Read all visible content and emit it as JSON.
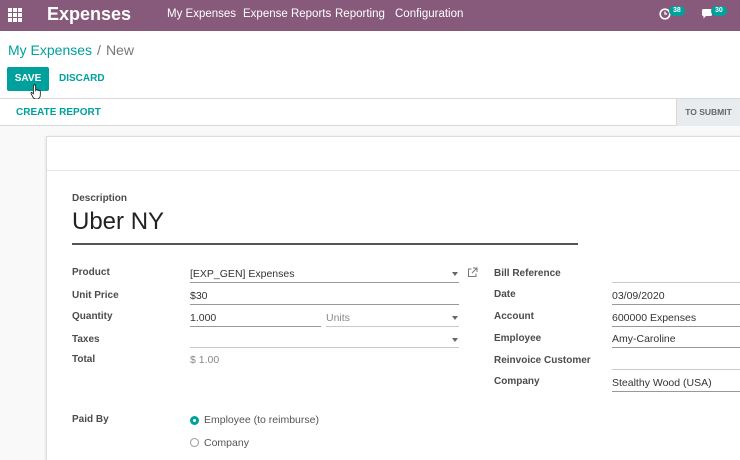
{
  "navbar": {
    "app_name": "Expenses",
    "menu": [
      "My Expenses",
      "Expense Reports",
      "Reporting",
      "Configuration"
    ],
    "activity_count": "38",
    "messages_count": "30"
  },
  "breadcrumb": {
    "parent": "My Expenses",
    "separator": "/",
    "current": "New"
  },
  "buttons": {
    "save": "SAVE",
    "discard": "DISCARD",
    "create_report": "CREATE REPORT"
  },
  "status": {
    "stage": "TO SUBMIT"
  },
  "form": {
    "description_label": "Description",
    "description_value": "Uber NY",
    "product": {
      "label": "Product",
      "value": "[EXP_GEN] Expenses"
    },
    "unit_price": {
      "label": "Unit Price",
      "value": "$30"
    },
    "quantity": {
      "label": "Quantity",
      "value": "1.000",
      "uom": "Units"
    },
    "taxes": {
      "label": "Taxes",
      "value": ""
    },
    "total": {
      "label": "Total",
      "value": "$ 1.00"
    },
    "bill_reference": {
      "label": "Bill Reference",
      "value": ""
    },
    "date": {
      "label": "Date",
      "value": "03/09/2020"
    },
    "account": {
      "label": "Account",
      "value": "600000 Expenses"
    },
    "employee": {
      "label": "Employee",
      "value": "Amy-Caroline"
    },
    "reinvoice_customer": {
      "label": "Reinvoice Customer",
      "value": ""
    },
    "company": {
      "label": "Company",
      "value": "Stealthy Wood (USA)"
    },
    "paid_by": {
      "label": "Paid By",
      "options": [
        "Employee (to reimburse)",
        "Company"
      ],
      "selected": "Employee (to reimburse)"
    }
  },
  "colors": {
    "navbar": "#875a7b",
    "accent": "#00a09d"
  },
  "icons": [
    "apps-grid-icon",
    "external-link-icon",
    "clock-icon",
    "chat-icon",
    "pointer-cursor-icon"
  ]
}
